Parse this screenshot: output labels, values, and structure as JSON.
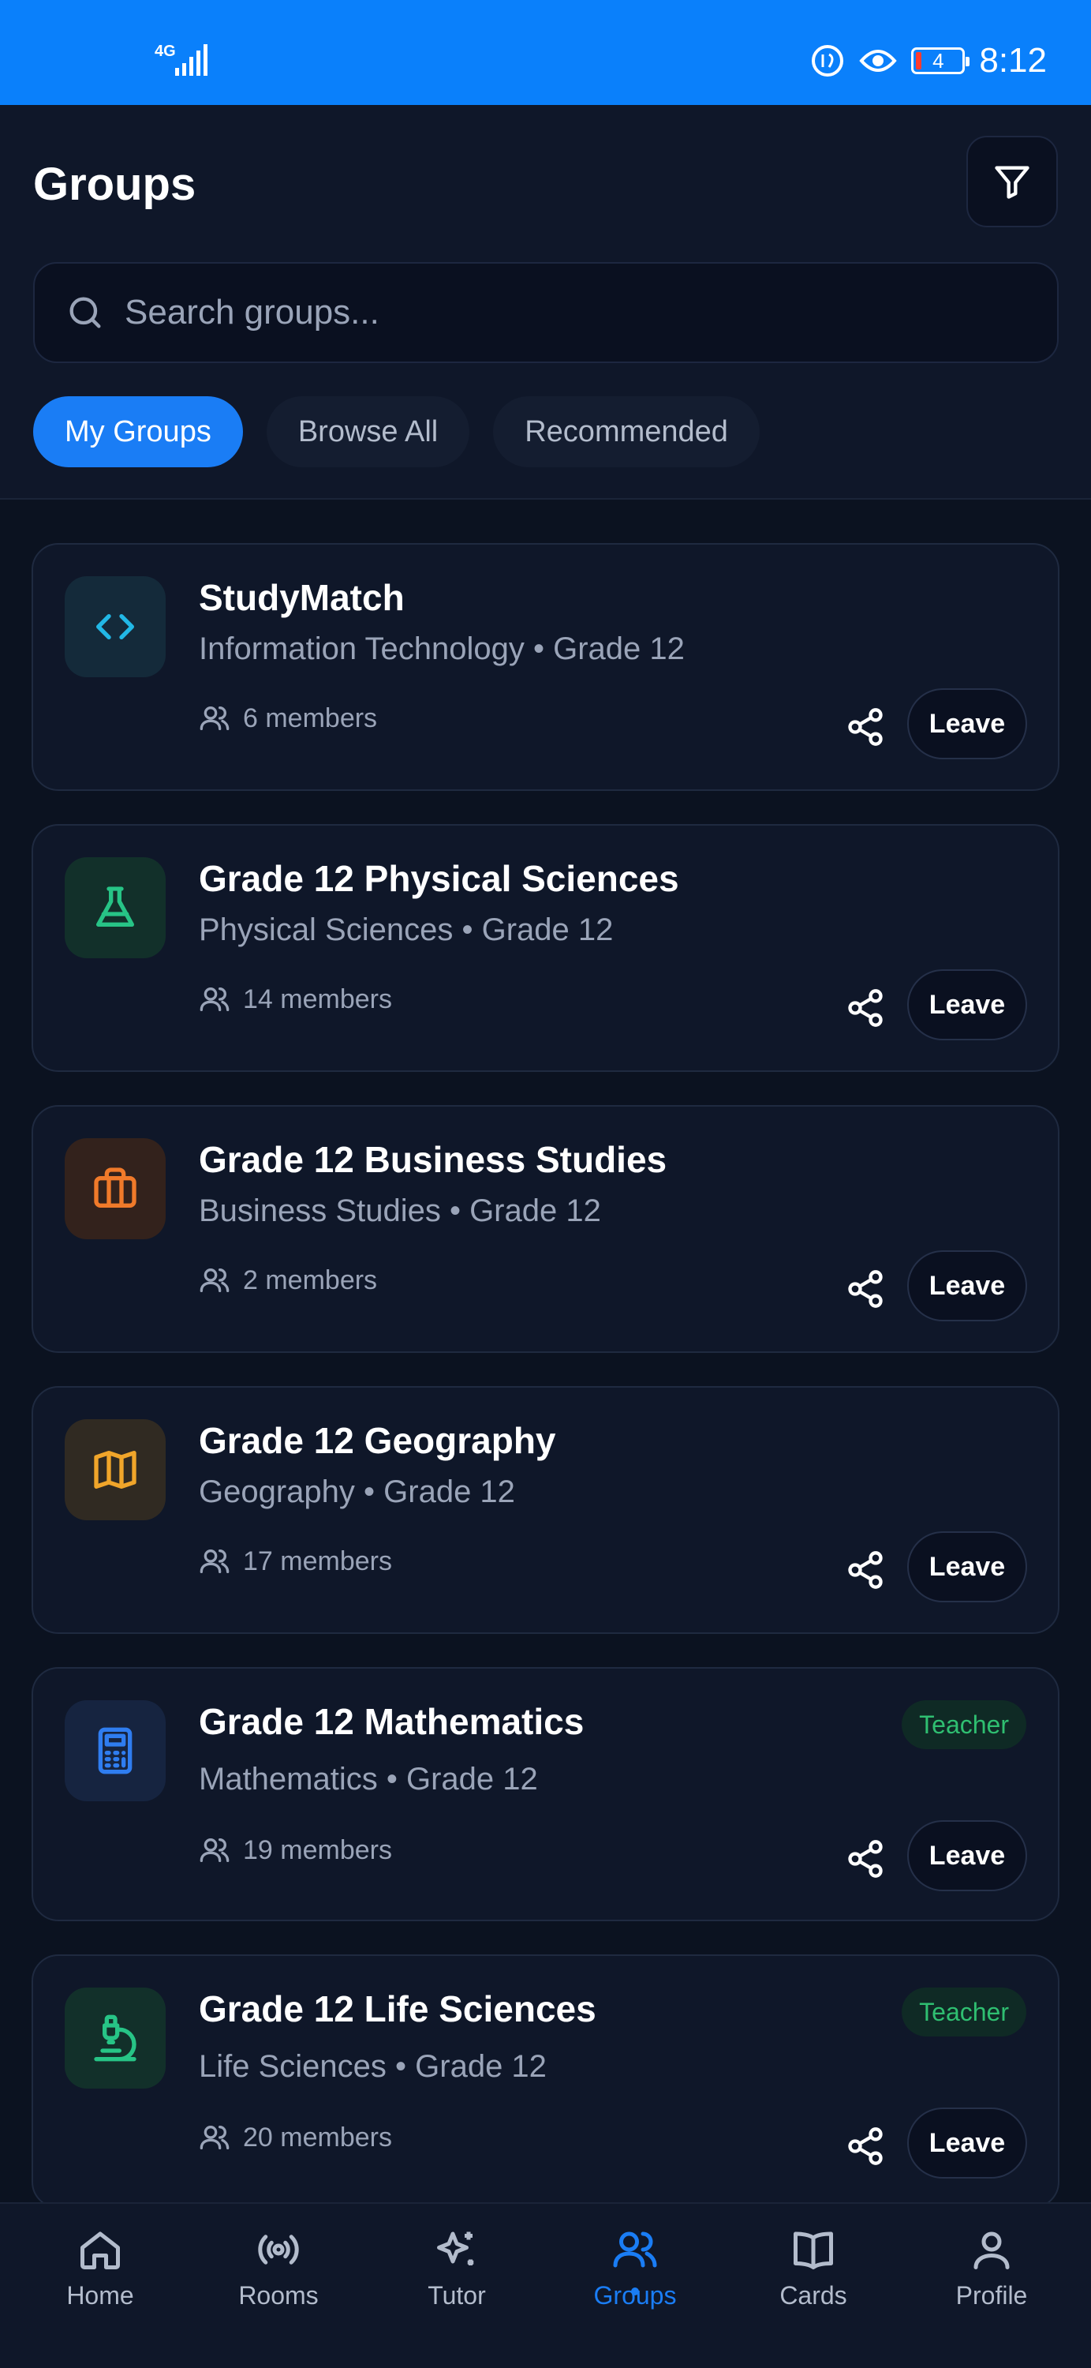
{
  "status_bar": {
    "network": "4G",
    "battery": "4",
    "time": "8:12"
  },
  "header": {
    "title": "Groups",
    "search_placeholder": "Search groups...",
    "tabs": [
      {
        "label": "My Groups",
        "active": true
      },
      {
        "label": "Browse All",
        "active": false
      },
      {
        "label": "Recommended",
        "active": false
      }
    ]
  },
  "groups": [
    {
      "name": "StudyMatch",
      "subtitle": "Information Technology • Grade 12",
      "members": "6 members",
      "icon": "code-icon",
      "icon_color": "#22b8e6",
      "icon_bg": "#142a3a",
      "badge": "",
      "action": "Leave"
    },
    {
      "name": "Grade 12 Physical Sciences",
      "subtitle": "Physical Sciences • Grade 12",
      "members": "14 members",
      "icon": "flask-icon",
      "icon_color": "#27c486",
      "icon_bg": "#12302a",
      "badge": "",
      "action": "Leave"
    },
    {
      "name": "Grade 12 Business Studies",
      "subtitle": "Business Studies • Grade 12",
      "members": "2 members",
      "icon": "briefcase-icon",
      "icon_color": "#f07a2a",
      "icon_bg": "#33221c",
      "badge": "",
      "action": "Leave"
    },
    {
      "name": "Grade 12 Geography",
      "subtitle": "Geography • Grade 12",
      "members": "17 members",
      "icon": "map-icon",
      "icon_color": "#f0a52a",
      "icon_bg": "#302a22",
      "badge": "",
      "action": "Leave"
    },
    {
      "name": "Grade 12 Mathematics",
      "subtitle": "Mathematics • Grade 12",
      "members": "19 members",
      "icon": "calculator-icon",
      "icon_color": "#2f7df0",
      "icon_bg": "#162440",
      "badge": "Teacher",
      "action": "Leave"
    },
    {
      "name": "Grade 12 Life Sciences",
      "subtitle": "Life Sciences • Grade 12",
      "members": "20 members",
      "icon": "microscope-icon",
      "icon_color": "#27c486",
      "icon_bg": "#12302a",
      "badge": "Teacher",
      "action": "Leave"
    }
  ],
  "bottom_nav": [
    {
      "label": "Home",
      "icon": "home-icon",
      "active": false
    },
    {
      "label": "Rooms",
      "icon": "broadcast-icon",
      "active": false
    },
    {
      "label": "Tutor",
      "icon": "sparkle-icon",
      "active": false
    },
    {
      "label": "Groups",
      "icon": "users-icon",
      "active": true
    },
    {
      "label": "Cards",
      "icon": "book-icon",
      "active": false
    },
    {
      "label": "Profile",
      "icon": "user-icon",
      "active": false
    }
  ]
}
